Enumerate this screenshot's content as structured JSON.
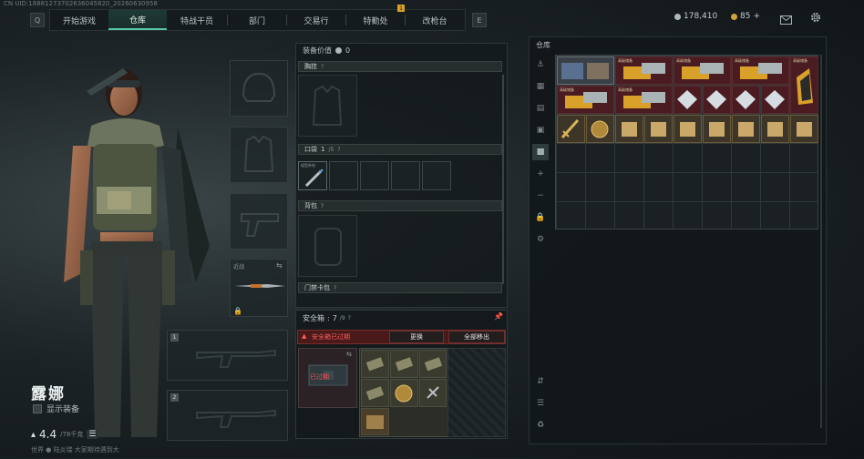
{
  "uid_text": "CN UID:18881273702636045820_20260630958",
  "nav": {
    "prev_key": "Q",
    "next_key": "E",
    "tabs": [
      {
        "label": "开始游戏"
      },
      {
        "label": "仓库"
      },
      {
        "label": "特战干员"
      },
      {
        "label": "部门"
      },
      {
        "label": "交易行"
      },
      {
        "label": "特勤处"
      },
      {
        "label": "改枪台"
      }
    ],
    "active_tab": "仓库",
    "notify_badge": "1"
  },
  "currency": {
    "silver": "178,410",
    "gold": "85",
    "gold_add": "+"
  },
  "icons": {
    "mail": "mail-icon",
    "settings": "gear-icon"
  },
  "character": {
    "name": "露娜",
    "show_gear_label": "显示装备",
    "weight": "4.4",
    "weight_max": "/78千克",
    "chat_text": "世界  ● 陆炎瑞  大家期待遇到大"
  },
  "equip": {
    "melee_label": "近战",
    "slot1_num": "1",
    "slot2_num": "2"
  },
  "loadout": {
    "gear_value_label": "装备价值",
    "gear_value": "0",
    "chest_rig_label": "胸挂",
    "pockets_label": "口袋",
    "pockets_count": "1",
    "pockets_max": "/5",
    "pocket_item_label": "轻型补给",
    "backpack_label": "背包",
    "keycard_label": "门禁卡包"
  },
  "safebox": {
    "label": "安全箱",
    "count": "7",
    "max": "/9",
    "warning": "安全箱已过期",
    "replace_button": "更换",
    "move_all_button": "全部移出",
    "expired_overlay": "已过期"
  },
  "warehouse": {
    "title": "仓库",
    "item_label": "高级储备",
    "side_icons": [
      "helmet-icon",
      "armor-icon",
      "bag-icon",
      "case-icon",
      "supply-icon",
      "plus-icon",
      "minus-icon",
      "lock-icon",
      "gear-small-icon"
    ],
    "bottom_icons": [
      "sort-icon",
      "layers-icon",
      "recycle-icon"
    ]
  }
}
